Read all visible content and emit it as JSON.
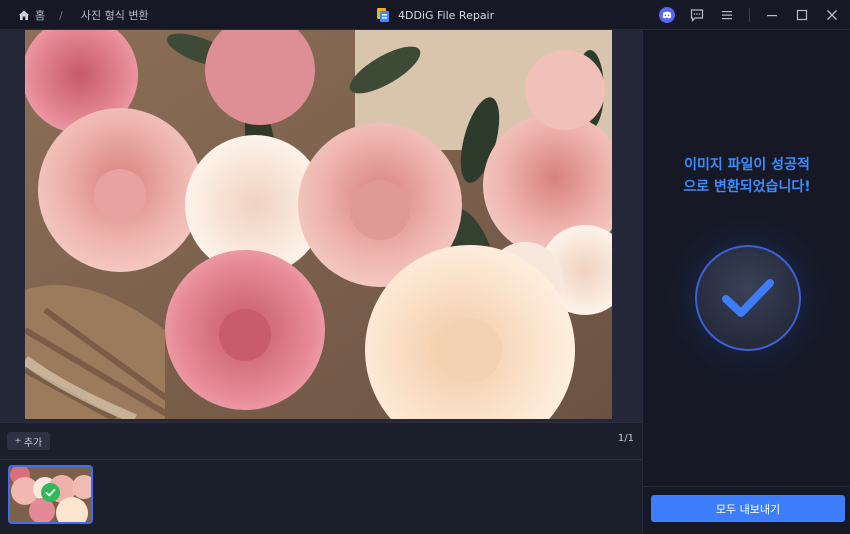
{
  "titlebar": {
    "home_label": "홈",
    "separator": "/",
    "page_label": "사진 형식 변환",
    "app_title": "4DDiG File Repair"
  },
  "toolbar": {
    "add_label": "추가",
    "add_prefix": "+",
    "page_count": "1/1"
  },
  "result": {
    "message_line1": "이미지 파일이 성공적",
    "message_line2": "으로 변환되었습니다!",
    "export_label": "모두 내보내기"
  },
  "colors": {
    "accent": "#3d7dfa",
    "success": "#2fb95b",
    "message": "#3d8cff"
  },
  "icons": [
    "home-icon",
    "app-logo-icon",
    "discord-icon",
    "feedback-icon",
    "menu-icon",
    "minimize-icon",
    "maximize-icon",
    "close-icon",
    "check-icon"
  ]
}
